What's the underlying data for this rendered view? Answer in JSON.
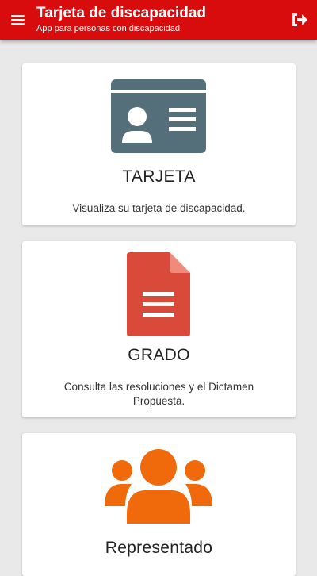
{
  "header": {
    "title": "Tarjeta de discapacidad",
    "subtitle": "App para personas con discapacidad",
    "background_color": "#d80c0c"
  },
  "cards": [
    {
      "title": "TARJETA",
      "description": "Visualiza su tarjeta de discapacidad.",
      "icon": "id-card-icon",
      "icon_color": "#546e7a"
    },
    {
      "title": "GRADO",
      "description": "Consulta las resoluciones y el Dictamen Propuesta.",
      "icon": "document-icon",
      "icon_color": "#d94a3a"
    },
    {
      "title": "Representado",
      "description": "",
      "icon": "users-group-icon",
      "icon_color": "#f06a0c"
    }
  ]
}
